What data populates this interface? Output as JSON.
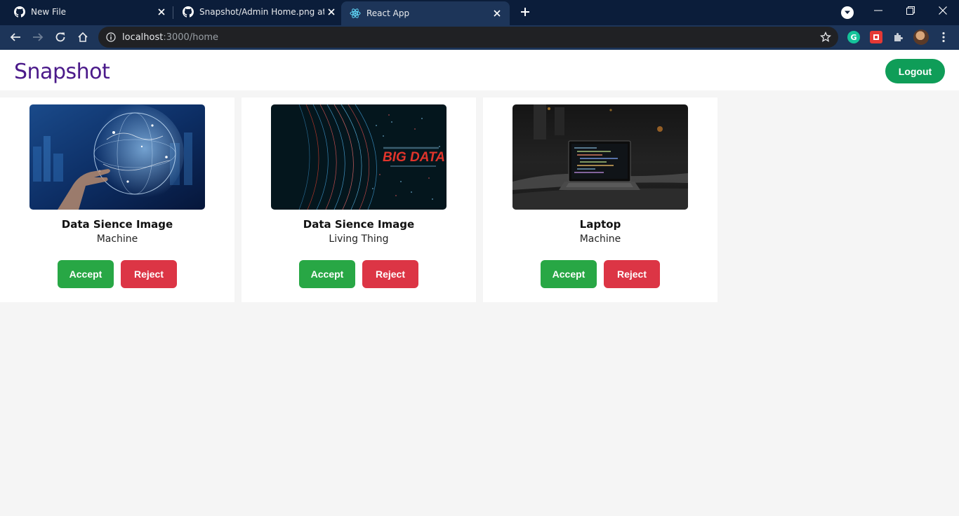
{
  "browser": {
    "tabs": [
      {
        "title": "New File"
      },
      {
        "title": "Snapshot/Admin Home.png at m"
      },
      {
        "title": "React App"
      }
    ],
    "url_host": "localhost",
    "url_rest": ":3000/home"
  },
  "app": {
    "brand": "Snapshot",
    "logout_label": "Logout"
  },
  "cards": [
    {
      "title": "Data Sience Image",
      "category": "Machine",
      "image": "globe-network-hand-image",
      "accept_label": "Accept",
      "reject_label": "Reject"
    },
    {
      "title": "Data Sience Image",
      "category": "Living Thing",
      "image": "big-data-visualization-image",
      "big_data_text": "BIG DATA",
      "accept_label": "Accept",
      "reject_label": "Reject"
    },
    {
      "title": "Laptop",
      "category": "Machine",
      "image": "laptop-dark-image",
      "accept_label": "Accept",
      "reject_label": "Reject"
    }
  ],
  "colors": {
    "tabstrip": "#0b1d3a",
    "toolbar": "#1d3559",
    "brand": "#4b1a8a",
    "logout": "#0f9d58",
    "accept": "#28a745",
    "reject": "#dc3545",
    "page_bg": "#f5f5f5"
  },
  "icons": {
    "tab_favicon_github": "github-icon",
    "tab_favicon_react": "react-icon",
    "tab_close": "close-icon",
    "new_tab": "plus-icon",
    "back": "back-arrow-icon",
    "forward": "forward-arrow-icon",
    "reload": "reload-icon",
    "home": "home-icon",
    "site_info": "info-icon",
    "bookmark": "star-icon",
    "extensions": "puzzle-icon",
    "menu": "kebab-menu-icon"
  }
}
